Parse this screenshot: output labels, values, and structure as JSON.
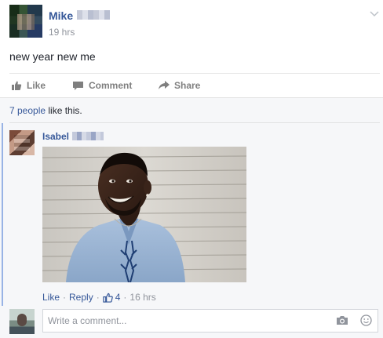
{
  "post": {
    "author": "Mike",
    "time": "19 hrs",
    "text": "new year new me"
  },
  "actions": {
    "like": "Like",
    "comment": "Comment",
    "share": "Share"
  },
  "likes": {
    "count_text": "7 people",
    "suffix": " like this."
  },
  "comment": {
    "author": "Isabel",
    "like": "Like",
    "reply": "Reply",
    "like_count": "4",
    "time": "16 hrs"
  },
  "composer": {
    "placeholder": "Write a comment..."
  },
  "colors": {
    "link": "#365899",
    "muted": "#90949c",
    "background_comments": "#f6f7f9"
  }
}
